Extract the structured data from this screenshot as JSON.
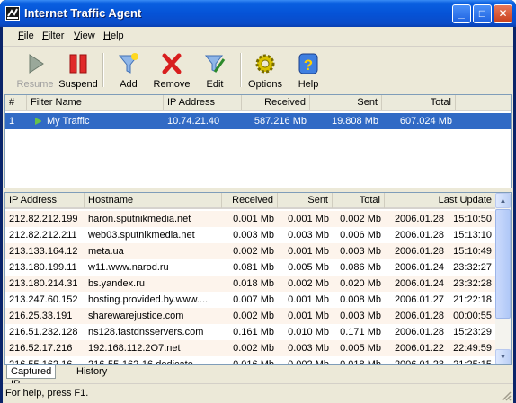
{
  "window": {
    "title": "Internet Traffic Agent"
  },
  "menu": [
    {
      "label": "File",
      "key": "F",
      "rest": "ile"
    },
    {
      "label": "Filter",
      "key": "F",
      "rest": "ilter"
    },
    {
      "label": "View",
      "key": "V",
      "rest": "iew"
    },
    {
      "label": "Help",
      "key": "H",
      "rest": "elp"
    }
  ],
  "toolbar": {
    "resume": "Resume",
    "suspend": "Suspend",
    "add": "Add",
    "remove": "Remove",
    "edit": "Edit",
    "options": "Options",
    "help": "Help"
  },
  "filters": {
    "columns": [
      "#",
      "Filter Name",
      "IP Address",
      "Received",
      "Sent",
      "Total"
    ],
    "rows": [
      {
        "num": "1",
        "name": "My Traffic",
        "ip": "10.74.21.40",
        "received": "587.216 Mb",
        "sent": "19.808 Mb",
        "total": "607.024 Mb",
        "selected": true
      }
    ]
  },
  "captured": {
    "columns": [
      "IP Address",
      "Hostname",
      "Received",
      "Sent",
      "Total",
      "Last Update"
    ],
    "rows": [
      {
        "ip": "212.82.212.199",
        "host": "haron.sputnikmedia.net",
        "received": "0.001 Mb",
        "sent": "0.001 Mb",
        "total": "0.002 Mb",
        "date": "2006.01.28",
        "time": "15:10:50"
      },
      {
        "ip": "212.82.212.211",
        "host": "web03.sputnikmedia.net",
        "received": "0.003 Mb",
        "sent": "0.003 Mb",
        "total": "0.006 Mb",
        "date": "2006.01.28",
        "time": "15:13:10"
      },
      {
        "ip": "213.133.164.12",
        "host": "meta.ua",
        "received": "0.002 Mb",
        "sent": "0.001 Mb",
        "total": "0.003 Mb",
        "date": "2006.01.28",
        "time": "15:10:49"
      },
      {
        "ip": "213.180.199.11",
        "host": "w11.www.narod.ru",
        "received": "0.081 Mb",
        "sent": "0.005 Mb",
        "total": "0.086 Mb",
        "date": "2006.01.24",
        "time": "23:32:27"
      },
      {
        "ip": "213.180.214.31",
        "host": "bs.yandex.ru",
        "received": "0.018 Mb",
        "sent": "0.002 Mb",
        "total": "0.020 Mb",
        "date": "2006.01.24",
        "time": "23:32:28"
      },
      {
        "ip": "213.247.60.152",
        "host": "hosting.provided.by.www....",
        "received": "0.007 Mb",
        "sent": "0.001 Mb",
        "total": "0.008 Mb",
        "date": "2006.01.27",
        "time": "21:22:18"
      },
      {
        "ip": "216.25.33.191",
        "host": "sharewarejustice.com",
        "received": "0.002 Mb",
        "sent": "0.001 Mb",
        "total": "0.003 Mb",
        "date": "2006.01.28",
        "time": "00:00:55"
      },
      {
        "ip": "216.51.232.128",
        "host": "ns128.fastdnsservers.com",
        "received": "0.161 Mb",
        "sent": "0.010 Mb",
        "total": "0.171 Mb",
        "date": "2006.01.28",
        "time": "15:23:29"
      },
      {
        "ip": "216.52.17.216",
        "host": "192.168.112.2O7.net",
        "received": "0.002 Mb",
        "sent": "0.003 Mb",
        "total": "0.005 Mb",
        "date": "2006.01.22",
        "time": "22:49:59"
      },
      {
        "ip": "216.55.162.16",
        "host": "216-55-162-16.dedicate...",
        "received": "0.016 Mb",
        "sent": "0.002 Mb",
        "total": "0.018 Mb",
        "date": "2006.01.23",
        "time": "21:25:15"
      }
    ]
  },
  "tabs": [
    "Captured IP",
    "History"
  ],
  "status": {
    "text": "For help, press F1."
  }
}
